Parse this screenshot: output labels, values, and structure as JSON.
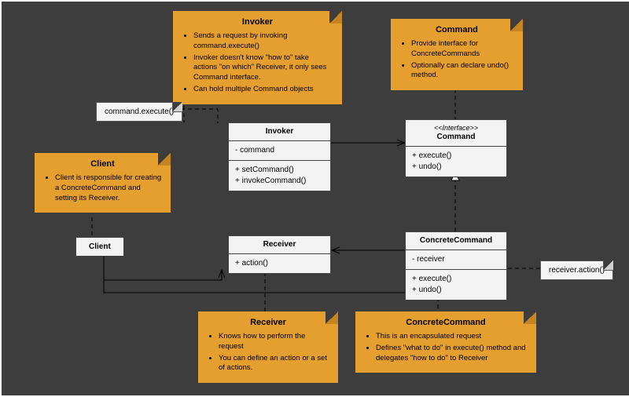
{
  "notes": {
    "invoker": {
      "title": "Invoker",
      "bullets": [
        "Sends a request by invoking command.execute()",
        "Invoker doesn't know \"how to\" take actions \"on which\" Receiver, it only sees Command interface.",
        "Can hold multiple Command objects"
      ]
    },
    "command": {
      "title": "Command",
      "bullets": [
        "Provide interface for ConcreteCommands",
        "Optionally can declare undo() method."
      ]
    },
    "client": {
      "title": "Client",
      "bullets": [
        "Client is responsible for creating a ConcreteCommand and setting its Receiver."
      ]
    },
    "receiver": {
      "title": "Receiver",
      "bullets": [
        "Knows how to perform the request",
        "You can define an action or a set of actions."
      ]
    },
    "concreteCommand": {
      "title": "ConcreteCommand",
      "bullets": [
        "This is an encapsulated request",
        "Defines \"what to do\" in execute() method and delegates \"how to do\" to Receiver"
      ]
    }
  },
  "miniNotes": {
    "commandExecute": "command.execute()",
    "receiverAction": "receiver.action()"
  },
  "classes": {
    "invoker": {
      "name": "Invoker",
      "attrs": [
        "- command"
      ],
      "ops": [
        "+ setCommand()",
        "+ invokeCommand()"
      ]
    },
    "command": {
      "stereotype": "<<Interface>>",
      "name": "Command",
      "ops": [
        "+ execute()",
        "+ undo()"
      ]
    },
    "receiver": {
      "name": "Receiver",
      "ops": [
        "+ action()"
      ]
    },
    "concreteCommand": {
      "name": "ConcreteCommand",
      "attrs": [
        "- receiver"
      ],
      "ops": [
        "+ execute()",
        "+ undo()"
      ]
    },
    "client": {
      "name": "Client"
    }
  }
}
